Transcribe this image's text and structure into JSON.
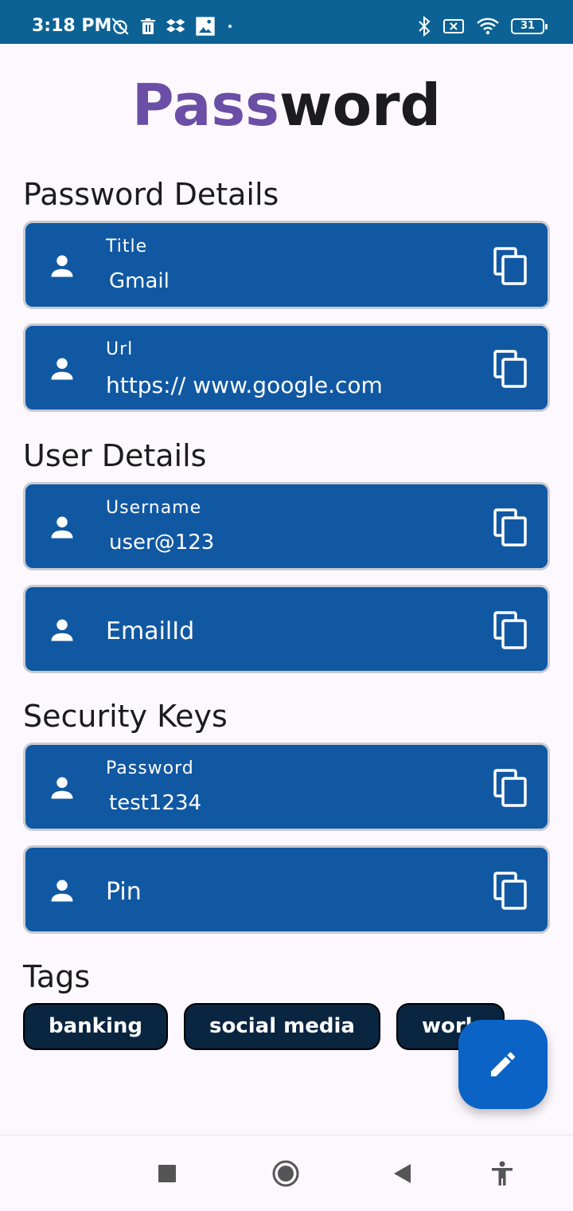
{
  "status_bar": {
    "time": "3:18 PM",
    "battery": "31",
    "icons": [
      "alarm-off-icon",
      "trash-icon",
      "dropbox-icon",
      "photo-icon",
      "dot-icon",
      "bluetooth-icon",
      "no-sim-icon",
      "wifi-icon",
      "battery-icon"
    ]
  },
  "header": {
    "title_accent": "Pass",
    "title_rest": "word"
  },
  "sections": {
    "password_details": "Password Details",
    "user_details": "User Details",
    "security_keys": "Security Keys",
    "tags": "Tags"
  },
  "fields": {
    "title": {
      "label": "Title",
      "value": "Gmail"
    },
    "url": {
      "label": "Url",
      "value": "https:// www.google.com"
    },
    "username": {
      "label": "Username",
      "value": "user@123"
    },
    "email": {
      "label": "",
      "value": "EmailId"
    },
    "password": {
      "label": "Password",
      "value": "test1234"
    },
    "pin": {
      "label": "",
      "value": "Pin"
    }
  },
  "tags": [
    "banking",
    "social media",
    "work"
  ],
  "fab": {
    "icon": "edit-pencil-icon"
  },
  "nav": {
    "icons": [
      "recents-square-icon",
      "home-circle-icon",
      "back-triangle-icon",
      "accessibility-icon"
    ]
  },
  "colors": {
    "accent": "#6b4ea5",
    "card": "#1158a3",
    "status_bar": "#0c6294",
    "tag": "#0a2540",
    "fab": "#0b63c5"
  }
}
